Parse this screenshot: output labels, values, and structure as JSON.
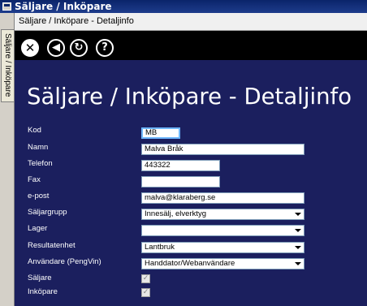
{
  "window": {
    "title": "Säljare / Inköpare"
  },
  "side_tab": {
    "label": "Säljare / Inköpare"
  },
  "document": {
    "header": "Säljare / Inköpare - Detaljinfo"
  },
  "toolbar": {
    "close_glyph": "✕",
    "back_glyph": "◀",
    "refresh_glyph": "↻",
    "help_glyph": "?"
  },
  "form": {
    "title": "Säljare / Inköpare - Detaljinfo",
    "fields": {
      "kod": {
        "label": "Kod",
        "value": "MB"
      },
      "namn": {
        "label": "Namn",
        "value": "Malva Bråk"
      },
      "telefon": {
        "label": "Telefon",
        "value": "443322"
      },
      "fax": {
        "label": "Fax",
        "value": ""
      },
      "epost": {
        "label": "e-post",
        "value": "malva@klaraberg.se"
      },
      "saljargrupp": {
        "label": "Säljargrupp",
        "value": "Innesälj, elverktyg"
      },
      "lager": {
        "label": "Lager",
        "value": ""
      },
      "resultatenhet": {
        "label": "Resultatenhet",
        "value": "Lantbruk"
      },
      "anvandare": {
        "label": "Användare (PengVin)",
        "value": "Handdator/Webanvändare"
      },
      "saljare": {
        "label": "Säljare",
        "checked": true,
        "glyph": "✓"
      },
      "inkopare": {
        "label": "Inköpare",
        "checked": true,
        "glyph": "✓"
      }
    }
  },
  "colors": {
    "content_bg": "#1b1f5e",
    "toolbar_bg": "#000000",
    "titlebar_bg": "#0a246a",
    "focus_border": "#6fb7ff"
  }
}
